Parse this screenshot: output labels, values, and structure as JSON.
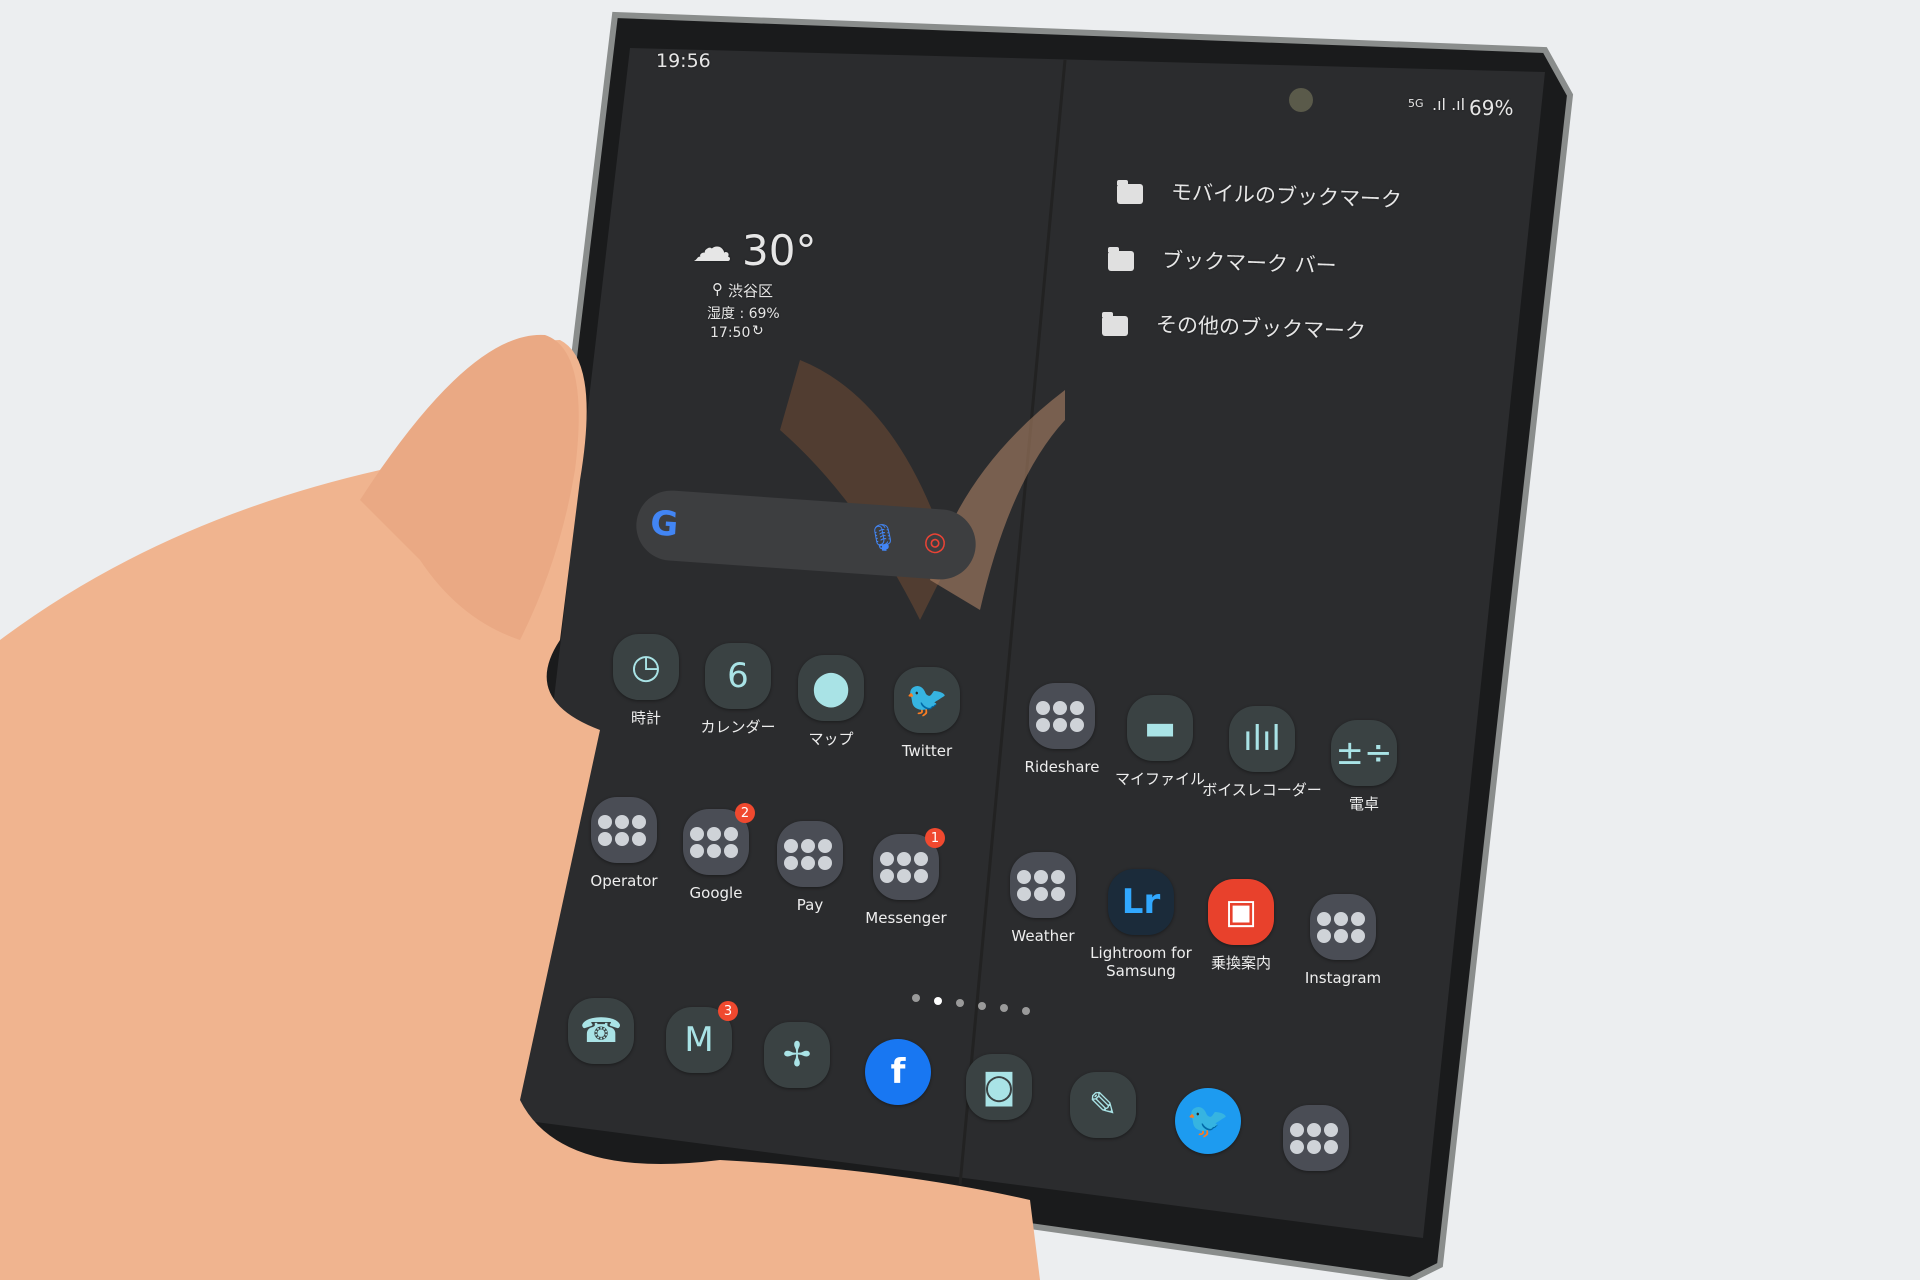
{
  "status_bar": {
    "time": "19:56",
    "battery": "69%",
    "network": "5G"
  },
  "weather_widget": {
    "temperature": "30°",
    "location": "渋谷区",
    "humidity": "湿度 : 69%",
    "updated": "17:50"
  },
  "bookmarks": [
    {
      "label": "モバイルのブックマーク"
    },
    {
      "label": "ブックマーク バー"
    },
    {
      "label": "その他のブックマーク"
    }
  ],
  "search_widget": {
    "logo": "G"
  },
  "apps": [
    {
      "label": "時計",
      "icon": "clock-icon"
    },
    {
      "label": "カレンダー",
      "icon": "calendar-icon",
      "glyph": "6"
    },
    {
      "label": "マップ",
      "icon": "map-pin-icon"
    },
    {
      "label": "Twitter",
      "icon": "twitter-icon"
    },
    {
      "label": "Rideshare",
      "icon": "folder-icon"
    },
    {
      "label": "マイファイル",
      "icon": "files-icon"
    },
    {
      "label": "ボイスレコーダー",
      "icon": "voice-recorder-icon"
    },
    {
      "label": "電卓",
      "icon": "calculator-icon"
    },
    {
      "label": "Operator",
      "icon": "folder-icon"
    },
    {
      "label": "Google",
      "icon": "folder-icon",
      "badge": "2"
    },
    {
      "label": "Pay",
      "icon": "folder-icon"
    },
    {
      "label": "Messenger",
      "icon": "folder-icon",
      "badge": "1"
    },
    {
      "label": "Weather",
      "icon": "folder-icon"
    },
    {
      "label": "Lightroom for\nSamsung",
      "icon": "lightroom-icon",
      "glyph": "Lr"
    },
    {
      "label": "乗換案内",
      "icon": "train-icon"
    },
    {
      "label": "Instagram",
      "icon": "folder-icon"
    }
  ],
  "dock": [
    {
      "icon": "phone-icon"
    },
    {
      "icon": "gmail-icon",
      "glyph": "M",
      "badge": "3"
    },
    {
      "icon": "pinwheel-icon"
    },
    {
      "icon": "facebook-icon",
      "glyph": "f"
    },
    {
      "icon": "camera-icon"
    },
    {
      "icon": "notes-icon"
    },
    {
      "icon": "twitter-icon"
    },
    {
      "icon": "folder-icon"
    }
  ],
  "page_indicator": {
    "pages": 6,
    "current": 2
  },
  "colors": {
    "screen": "#2b2c2e",
    "accent_icon": "#a9e3e6",
    "badge": "#f0492f",
    "skin": "#f0b48f"
  }
}
